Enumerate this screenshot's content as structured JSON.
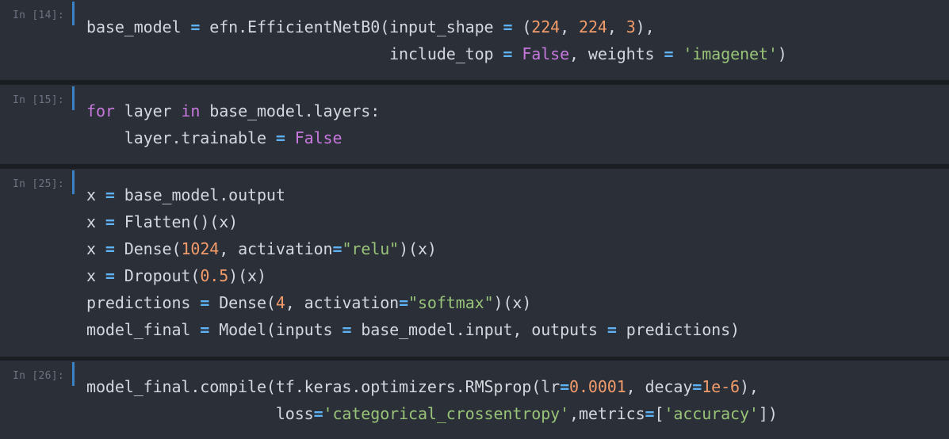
{
  "cells": [
    {
      "prompt": "In [14]:",
      "lines": [
        [
          [
            "t",
            "base_model "
          ],
          [
            "op",
            "="
          ],
          [
            "t",
            " efn.EfficientNetB0(input_shape "
          ],
          [
            "op",
            "="
          ],
          [
            "t",
            " ("
          ],
          [
            "num",
            "224"
          ],
          [
            "t",
            ", "
          ],
          [
            "num",
            "224"
          ],
          [
            "t",
            ", "
          ],
          [
            "num",
            "3"
          ],
          [
            "t",
            "),"
          ]
        ],
        [
          [
            "t",
            "                                include_top "
          ],
          [
            "op",
            "="
          ],
          [
            "t",
            " "
          ],
          [
            "const",
            "False"
          ],
          [
            "t",
            ", weights "
          ],
          [
            "op",
            "="
          ],
          [
            "t",
            " "
          ],
          [
            "str",
            "'imagenet'"
          ],
          [
            "t",
            ")"
          ]
        ]
      ]
    },
    {
      "prompt": "In [15]:",
      "lines": [
        [
          [
            "kw",
            "for"
          ],
          [
            "t",
            " layer "
          ],
          [
            "kw",
            "in"
          ],
          [
            "t",
            " base_model.layers:"
          ]
        ],
        [
          [
            "t",
            "    layer.trainable "
          ],
          [
            "op",
            "="
          ],
          [
            "t",
            " "
          ],
          [
            "const",
            "False"
          ]
        ]
      ]
    },
    {
      "prompt": "In [25]:",
      "lines": [
        [
          [
            "t",
            "x "
          ],
          [
            "op",
            "="
          ],
          [
            "t",
            " base_model.output"
          ]
        ],
        [
          [
            "t",
            "x "
          ],
          [
            "op",
            "="
          ],
          [
            "t",
            " Flatten()(x)"
          ]
        ],
        [
          [
            "t",
            "x "
          ],
          [
            "op",
            "="
          ],
          [
            "t",
            " Dense("
          ],
          [
            "num",
            "1024"
          ],
          [
            "t",
            ", activation"
          ],
          [
            "op",
            "="
          ],
          [
            "str",
            "\"relu\""
          ],
          [
            "t",
            ")(x)"
          ]
        ],
        [
          [
            "t",
            "x "
          ],
          [
            "op",
            "="
          ],
          [
            "t",
            " Dropout("
          ],
          [
            "num",
            "0.5"
          ],
          [
            "t",
            ")(x)"
          ]
        ],
        [
          [
            "t",
            "predictions "
          ],
          [
            "op",
            "="
          ],
          [
            "t",
            " Dense("
          ],
          [
            "num",
            "4"
          ],
          [
            "t",
            ", activation"
          ],
          [
            "op",
            "="
          ],
          [
            "str",
            "\"softmax\""
          ],
          [
            "t",
            ")(x)"
          ]
        ],
        [
          [
            "t",
            "model_final "
          ],
          [
            "op",
            "="
          ],
          [
            "t",
            " Model(inputs "
          ],
          [
            "op",
            "="
          ],
          [
            "t",
            " base_model.input, outputs "
          ],
          [
            "op",
            "="
          ],
          [
            "t",
            " predictions)"
          ]
        ]
      ]
    },
    {
      "prompt": "In [26]:",
      "lines": [
        [
          [
            "t",
            "model_final.compile(tf.keras.optimizers.RMSprop(lr"
          ],
          [
            "op",
            "="
          ],
          [
            "num",
            "0.0001"
          ],
          [
            "t",
            ", decay"
          ],
          [
            "op",
            "="
          ],
          [
            "num",
            "1e-6"
          ],
          [
            "t",
            "),"
          ]
        ],
        [
          [
            "t",
            "                    loss"
          ],
          [
            "op",
            "="
          ],
          [
            "str",
            "'categorical_crossentropy'"
          ],
          [
            "t",
            ",metrics"
          ],
          [
            "op",
            "="
          ],
          [
            "t",
            "["
          ],
          [
            "str",
            "'accuracy'"
          ],
          [
            "t",
            "])"
          ]
        ]
      ]
    }
  ]
}
